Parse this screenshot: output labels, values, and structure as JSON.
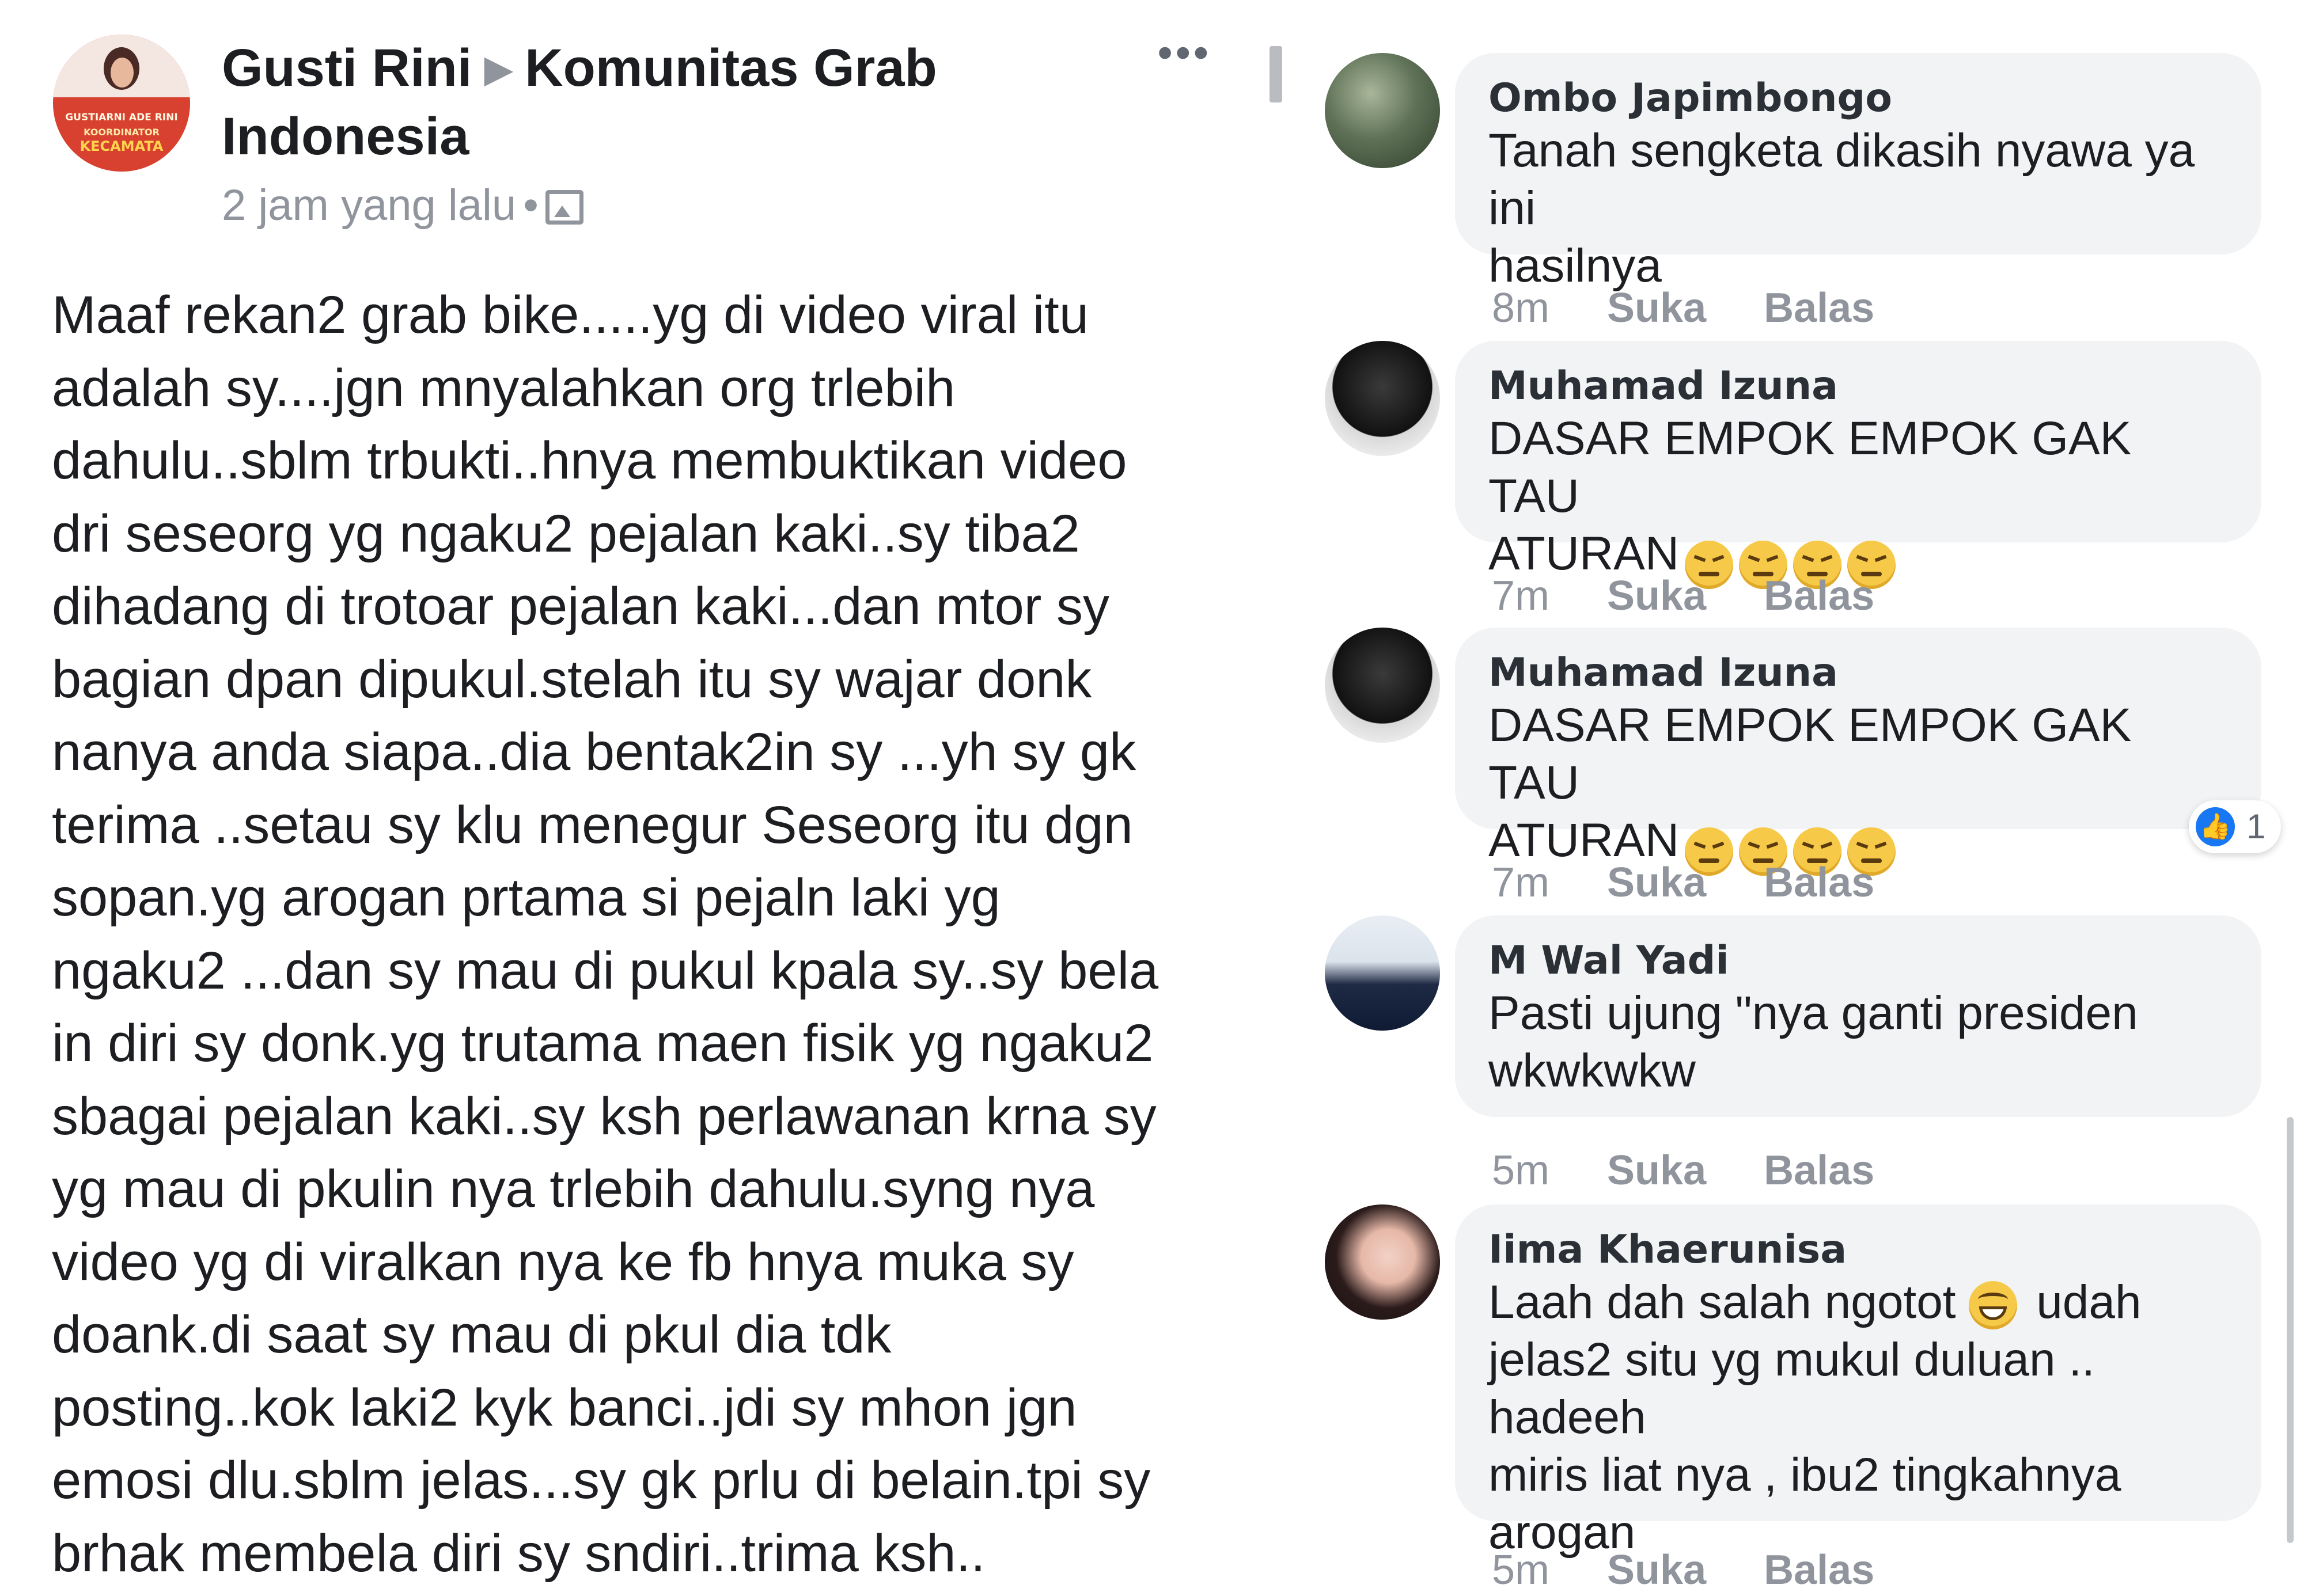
{
  "post": {
    "author": "Gusti Rini",
    "group": "Komunitas Grab Indonesia",
    "time": "2 jam yang lalu",
    "avatar_caption_1": "GUSTIARNI ADE RINI",
    "avatar_caption_2": "KOORDINATOR",
    "avatar_caption_3": "KECAMATA",
    "body": "Maaf rekan2 grab bike.....yg di video viral itu\nadalah sy....jgn mnyalahkan org trlebih\ndahulu..sblm trbukti..hnya membuktikan video\ndri seseorg yg ngaku2 pejalan kaki..sy tiba2\ndihadang di trotoar pejalan kaki...dan mtor sy\nbagian dpan dipukul.stelah itu sy wajar donk\nnanya anda siapa..dia bentak2in sy ...yh sy gk\nterima ..setau sy klu menegur Seseorg itu dgn\nsopan.yg arogan prtama si pejaln laki yg\nngaku2 ...dan sy mau di pukul kpala sy..sy bela\nin diri sy donk.yg trutama maen fisik yg ngaku2\nsbagai pejalan kaki..sy ksh perlawanan krna sy\nyg mau di pkulin nya trlebih dahulu.syng nya\nvideo yg di viralkan nya ke fb hnya muka sy\ndoank.di saat sy mau di pkul dia tdk\nposting..kok laki2 kyk banci..jdi sy mhon jgn\nemosi dlu.sblm jelas...sy gk prlu di belain.tpi sy\nbrhak membela diri sy sndiri..trima ksh.."
  },
  "comments": [
    {
      "name": "Ombo Japimbongo",
      "text": "Tanah sengketa dikasih nyawa ya ini\nhasilnya",
      "time": "8m",
      "like": "Suka",
      "reply": "Balas"
    },
    {
      "name": "Muhamad Izuna",
      "text_line1": "DASAR EMPOK EMPOK GAK TAU",
      "text_line2": "ATURAN",
      "time": "7m",
      "like": "Suka",
      "reply": "Balas"
    },
    {
      "name": "Muhamad Izuna",
      "text_line1": "DASAR EMPOK EMPOK GAK TAU",
      "text_line2": "ATURAN",
      "time": "7m",
      "like": "Suka",
      "reply": "Balas",
      "reaction_count": "1"
    },
    {
      "name": "M Wal Yadi",
      "text": "Pasti ujung \"nya ganti presiden\nwkwkwkw",
      "time": "5m",
      "like": "Suka",
      "reply": "Balas"
    },
    {
      "name": "Iima Khaerunisa",
      "text_a": "Laah dah salah ngotot",
      "text_b": "udah",
      "text_rest": "jelas2 situ yg mukul duluan .. hadeeh\nmiris liat nya , ibu2 tingkahnya\narogan",
      "time": "5m",
      "like": "Suka",
      "reply": "Balas"
    }
  ],
  "icons": {
    "more": "more-horizontal-icon",
    "photo": "photo-icon",
    "reaction": "like-thumb-icon"
  },
  "colors": {
    "bubble": "#f2f3f5",
    "meta_text": "#90949c",
    "like_blue": "#1877f2",
    "emoji_yellow": "#f7c948"
  }
}
